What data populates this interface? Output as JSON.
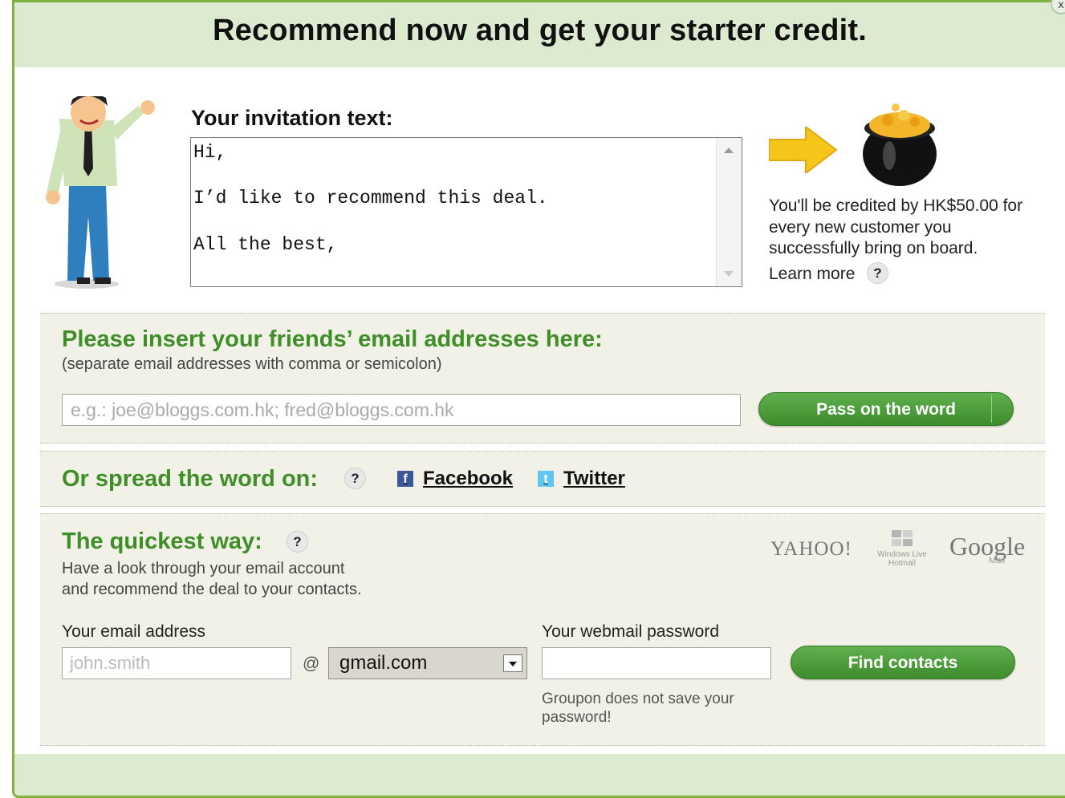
{
  "header": {
    "title": "Recommend now and get your starter credit.",
    "close_label": "x"
  },
  "invitation": {
    "label": "Your invitation text:",
    "body": "Hi,\n\nI’d like to recommend this deal.\n\nAll the best,"
  },
  "credit": {
    "text": "You'll be credited by HK$50.00 for every new customer you successfully bring on board.",
    "learn_more": "Learn more",
    "help": "?"
  },
  "friends": {
    "title": "Please insert your friends’ email addresses here:",
    "subtitle": "(separate email addresses with comma or semicolon)",
    "placeholder": "e.g.: joe@bloggs.com.hk; fred@bloggs.com.hk",
    "button": "Pass on the word"
  },
  "spread": {
    "title": "Or spread the word on:",
    "help": "?",
    "facebook": "Facebook",
    "facebook_icon_char": "f",
    "twitter": "Twitter",
    "twitter_icon_char": "t"
  },
  "quickest": {
    "title": "The quickest way:",
    "help": "?",
    "desc_line1": "Have a look through your email account",
    "desc_line2": "and recommend the deal to your contacts.",
    "providers": {
      "yahoo": "YAHOO!",
      "windows": "Windows Live Hotmail",
      "google": "Google",
      "gmail": "Mail"
    },
    "email_label": "Your email address",
    "email_placeholder": "john.smith",
    "at": "@",
    "domain": "gmail.com",
    "password_label": "Your webmail password",
    "button": "Find contacts",
    "note": "Groupon does not save your password!"
  }
}
